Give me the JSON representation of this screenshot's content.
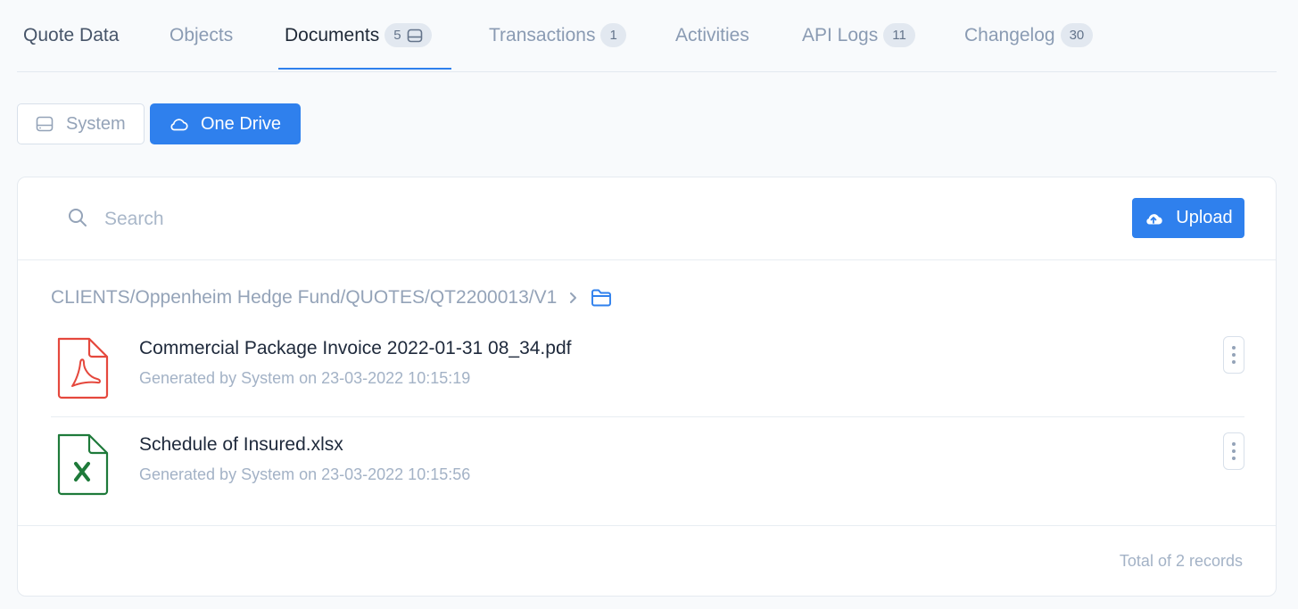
{
  "tabs": [
    {
      "label": "Quote Data",
      "badge": null
    },
    {
      "label": "Objects",
      "badge": null
    },
    {
      "label": "Documents",
      "badge": "5",
      "badge_icon": "drive-icon",
      "active": true
    },
    {
      "label": "Transactions",
      "badge": "1"
    },
    {
      "label": "Activities",
      "badge": null
    },
    {
      "label": "API Logs",
      "badge": "11"
    },
    {
      "label": "Changelog",
      "badge": "30"
    }
  ],
  "storage": {
    "system_label": "System",
    "system_icon": "drive-icon",
    "onedrive_label": "One Drive",
    "onedrive_icon": "cloud-icon",
    "selected": "One Drive"
  },
  "search": {
    "placeholder": "Search",
    "value": ""
  },
  "upload": {
    "label": "Upload",
    "icon": "cloud-upload-icon"
  },
  "breadcrumb": {
    "path": "CLIENTS/Oppenheim Hedge Fund/QUOTES/QT2200013/V1",
    "separator_icon": "chevron-right-icon",
    "folder_icon": "folder-icon"
  },
  "files": [
    {
      "name": "Commercial Package Invoice 2022-01-31 08_34.pdf",
      "meta": "Generated by System on 23-03-2022 10:15:19",
      "icon": "pdf-file-icon"
    },
    {
      "name": "Schedule of Insured.xlsx",
      "meta": "Generated by System on 23-03-2022 10:15:56",
      "icon": "excel-file-icon"
    }
  ],
  "footer": {
    "total": "Total of 2 records"
  },
  "colors": {
    "accent": "#2f80ed",
    "pdf": "#e5483d",
    "excel": "#1e7a3a",
    "muted": "#94a3b8"
  }
}
